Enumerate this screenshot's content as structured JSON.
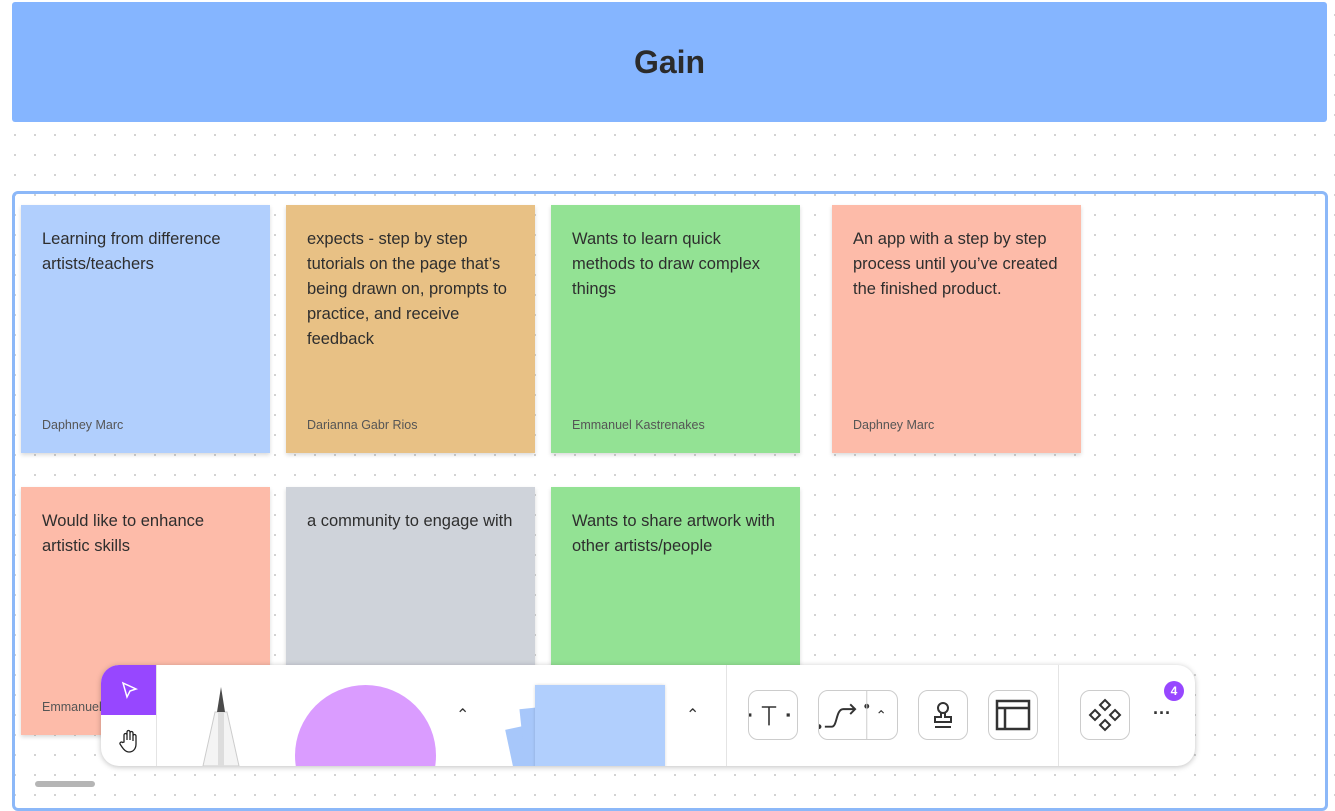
{
  "header": {
    "title": "Gain",
    "color": "#85b5ff"
  },
  "cards": [
    {
      "text": "Learning from difference artists/teachers",
      "author": "Daphney Marc",
      "color": "#b1cffd"
    },
    {
      "text": "expects - step by step tutorials on the page that’s being drawn on, prompts to practice, and receive feedback",
      "author": "Darianna Gabr Rios",
      "color": "#e8c185"
    },
    {
      "text": "Wants to learn quick methods to draw complex things",
      "author": "Emmanuel Kastrenakes",
      "color": "#93e294"
    },
    {
      "text": "An app with a step by step process until you’ve created the finished product.",
      "author": "Daphney Marc",
      "color": "#fdbba9"
    },
    {
      "text": "Would like to enhance artistic skills",
      "author": "Emmanuel",
      "color": "#fdbba9"
    },
    {
      "text": "a community to engage with",
      "author": "",
      "color": "#cfd3da"
    },
    {
      "text": "Wants to share artwork with other artists/people",
      "author": "",
      "color": "#93e294"
    }
  ],
  "toolbar": {
    "more_badge": "4",
    "more_label": "···",
    "accent": "#9747ff"
  }
}
